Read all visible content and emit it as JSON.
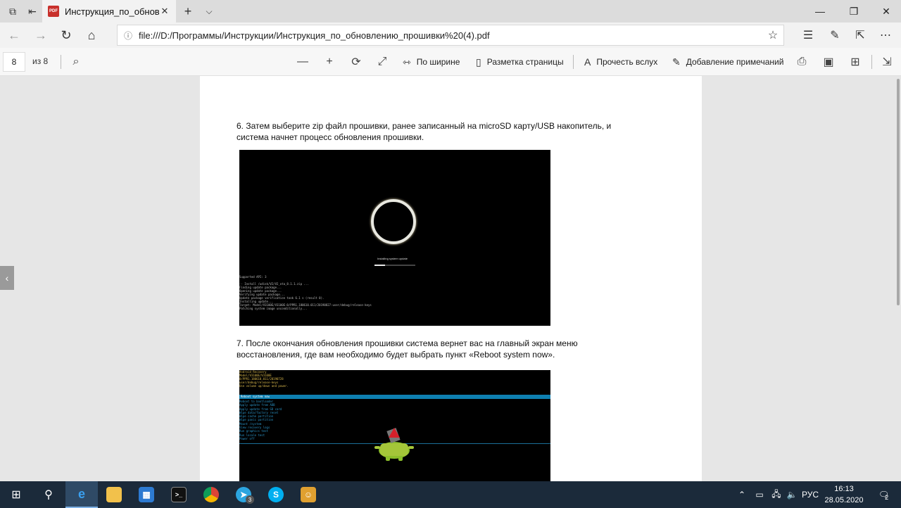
{
  "browser": {
    "tab_title": "Инструкция_по_обнов.",
    "tab_badge": "PDF",
    "new_tab_glyph": "+",
    "url": "file:///D:/Программы/Инструкции/Инструкция_по_обновлению_прошивки%20(4).pdf"
  },
  "pdf_toolbar": {
    "current_page": "8",
    "page_total": "из 8",
    "fit_width_label": "По ширине",
    "page_layout_label": "Разметка страницы",
    "read_aloud_label": "Прочесть вслух",
    "add_notes_label": "Добавление примечаний"
  },
  "document": {
    "step6_line1": "6. Затем выберите zip файл прошивки, ранее записанный на microSD карту/USB накопитель, и",
    "step6_line2": "система начнет процесс обновления прошивки.",
    "step7_line1": "7. После окончания обновления прошивки система вернет вас на главный экран меню",
    "step7_line2": "восстановления, где вам необходимо будет выбрать пункт «Reboot system now».",
    "screenshot1": {
      "installing_text": "Installing system update",
      "progress_fraction": 0.25,
      "terminal": "Supported API: 3\n\n-- Install /udisk/V2/V2_ota_8.1.1.zip ...\nFinding update package...\nOpening update package...\nVerifying update package...\nUpdate package verification took 6.1 s (result 0).\nInstalling update...\nTarget: Model/V3100E/V3100E:8/PPR1.180610.011/20190827:user/debug/release-keys\nPatching system image unconditionally..."
    },
    "screenshot2": {
      "header": "Android Recovery\nModel/V3100E/V3100E\n8/PPR1.180610.011/20190728\nuser/debug/release-keys\nUse volume up/down and power.",
      "selected_item": "Reboot system now",
      "menu": "Reboot to bootloader\nApply update from ADB\nApply update from SD card\nWipe data/factory reset\nWipe cache partition\nWipe panic partition\nMount /system\nView recovery logs\nRun graphics test\nRun locale test\nPower off"
    }
  },
  "taskbar": {
    "telegram_badge": "3",
    "language": "РУС",
    "time": "16:13",
    "date": "28.05.2020",
    "notifications_count": "2"
  },
  "colors": {
    "taskbar_bg": "#1b2a3a",
    "recovery_highlight": "#0e7fb0",
    "recovery_header": "#d9b84c",
    "pdf_badge": "#c8302b"
  }
}
